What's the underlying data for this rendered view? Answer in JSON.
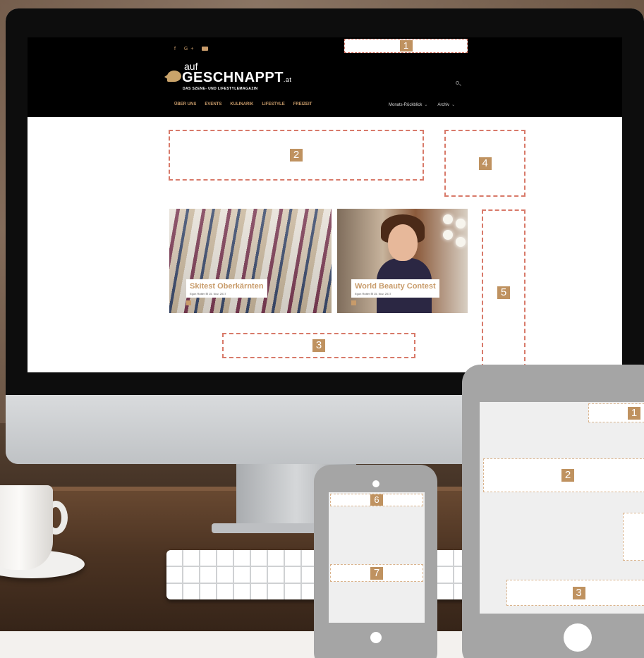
{
  "site": {
    "social_icons": [
      "facebook-icon",
      "google-plus-icon",
      "youtube-icon"
    ],
    "social_glyphs": {
      "facebook": "f",
      "google_plus": "G+"
    },
    "logo": {
      "prefix": "auf",
      "name": "GESCHNAPPT",
      "suffix": ".at",
      "tagline": "DAS SZENE- UND LIFESTYLEMAGAZIN"
    },
    "nav": [
      "ÜBER UNS",
      "EVENTS",
      "KULINARIK",
      "LIFESTYLE",
      "FREIZEIT"
    ],
    "nav_right": [
      {
        "label": "Monats-Rückblick",
        "caret": "⌄"
      },
      {
        "label": "Archiv",
        "caret": "⌄"
      }
    ]
  },
  "cards": [
    {
      "title": "Skitest Oberkärnten",
      "meta": "Egon Rutter  ⊞ 15. Nov. 2017"
    },
    {
      "title": "World Beauty Contest",
      "meta": "Egon Rutter  ⊞ 15. Nov. 2017"
    }
  ],
  "ad_slots": {
    "desktop": [
      "1",
      "2",
      "3",
      "4",
      "5"
    ],
    "tablet": [
      "1",
      "2",
      "3"
    ],
    "phone": [
      "6",
      "7"
    ]
  },
  "colors": {
    "accent": "#c89b6a",
    "ad_border": "#d87a6a",
    "badge": "#bf9260"
  }
}
